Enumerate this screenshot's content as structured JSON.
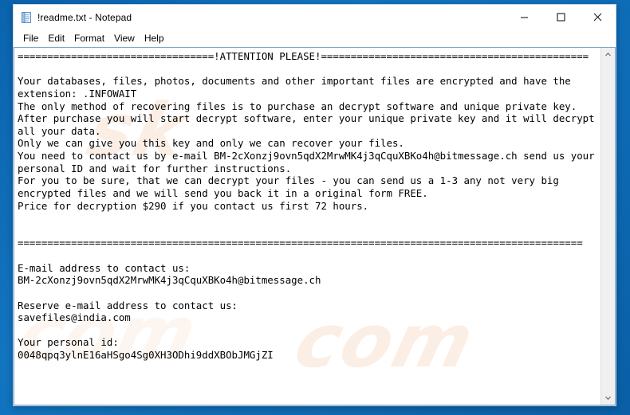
{
  "window": {
    "title": "!readme.txt - Notepad",
    "icon": "notepad-document-icon",
    "filename": "!readme.txt",
    "app_name": "Notepad"
  },
  "titlebar_buttons": {
    "minimize": "–",
    "maximize": "☐",
    "close": "✕",
    "minimize_name": "minimize",
    "maximize_name": "maximize",
    "close_name": "close"
  },
  "menubar": {
    "items": [
      {
        "label": "File"
      },
      {
        "label": "Edit"
      },
      {
        "label": "Format"
      },
      {
        "label": "View"
      },
      {
        "label": "Help"
      }
    ]
  },
  "scrollbar": {
    "up_arrow": "⌃",
    "down_arrow": "⌄"
  },
  "watermark": {
    "line1": "com",
    "line2": "com",
    "line3": "sk"
  },
  "colors": {
    "desktop_blue": "#0d6ab4",
    "window_bg": "#ffffff",
    "text": "#000000",
    "border": "#7fa5c4",
    "scrollbar_bg": "#f0f0f0",
    "watermark": "#fbeee4"
  },
  "document": {
    "text": "=================================!ATTENTION PLEASE!=============================================\n\nYour databases, files, photos, documents and other important files are encrypted and have the\nextension: .INFOWAIT\nThe only method of recovering files is to purchase an decrypt software and unique private key.\nAfter purchase you will start decrypt software, enter your unique private key and it will decrypt\nall your data.\nOnly we can give you this key and only we can recover your files.\nYou need to contact us by e-mail BM-2cXonzj9ovn5qdX2MrwMK4j3qCquXBKo4h@bitmessage.ch send us your\npersonal ID and wait for further instructions.\nFor you to be sure, that we can decrypt your files - you can send us a 1-3 any not very big\nencrypted files and we will send you back it in a original form FREE.\nPrice for decryption $290 if you contact us first 72 hours.\n\n\n===============================================================================================\n\nE-mail address to contact us:\nBM-2cXonzj9ovn5qdX2MrwMK4j3qCquXBKo4h@bitmessage.ch\n\nReserve e-mail address to contact us:\nsavefiles@india.com\n\nYour personal id:\n0048qpq3ylnE16aHSgo4Sg0XH3ODhi9ddXBObJMGjZI",
    "attention_header": "!ATTENTION PLEASE!",
    "file_extension": ".INFOWAIT",
    "price": "$290",
    "deadline_hours": "72",
    "contact_email_primary": "BM-2cXonzj9ovn5qdX2MrwMK4j3qCquXBKo4h@bitmessage.ch",
    "contact_email_reserve": "savefiles@india.com",
    "personal_id": "0048qpq3ylnE16aHSgo4Sg0XH3ODhi9ddXBObJMGjZI"
  }
}
